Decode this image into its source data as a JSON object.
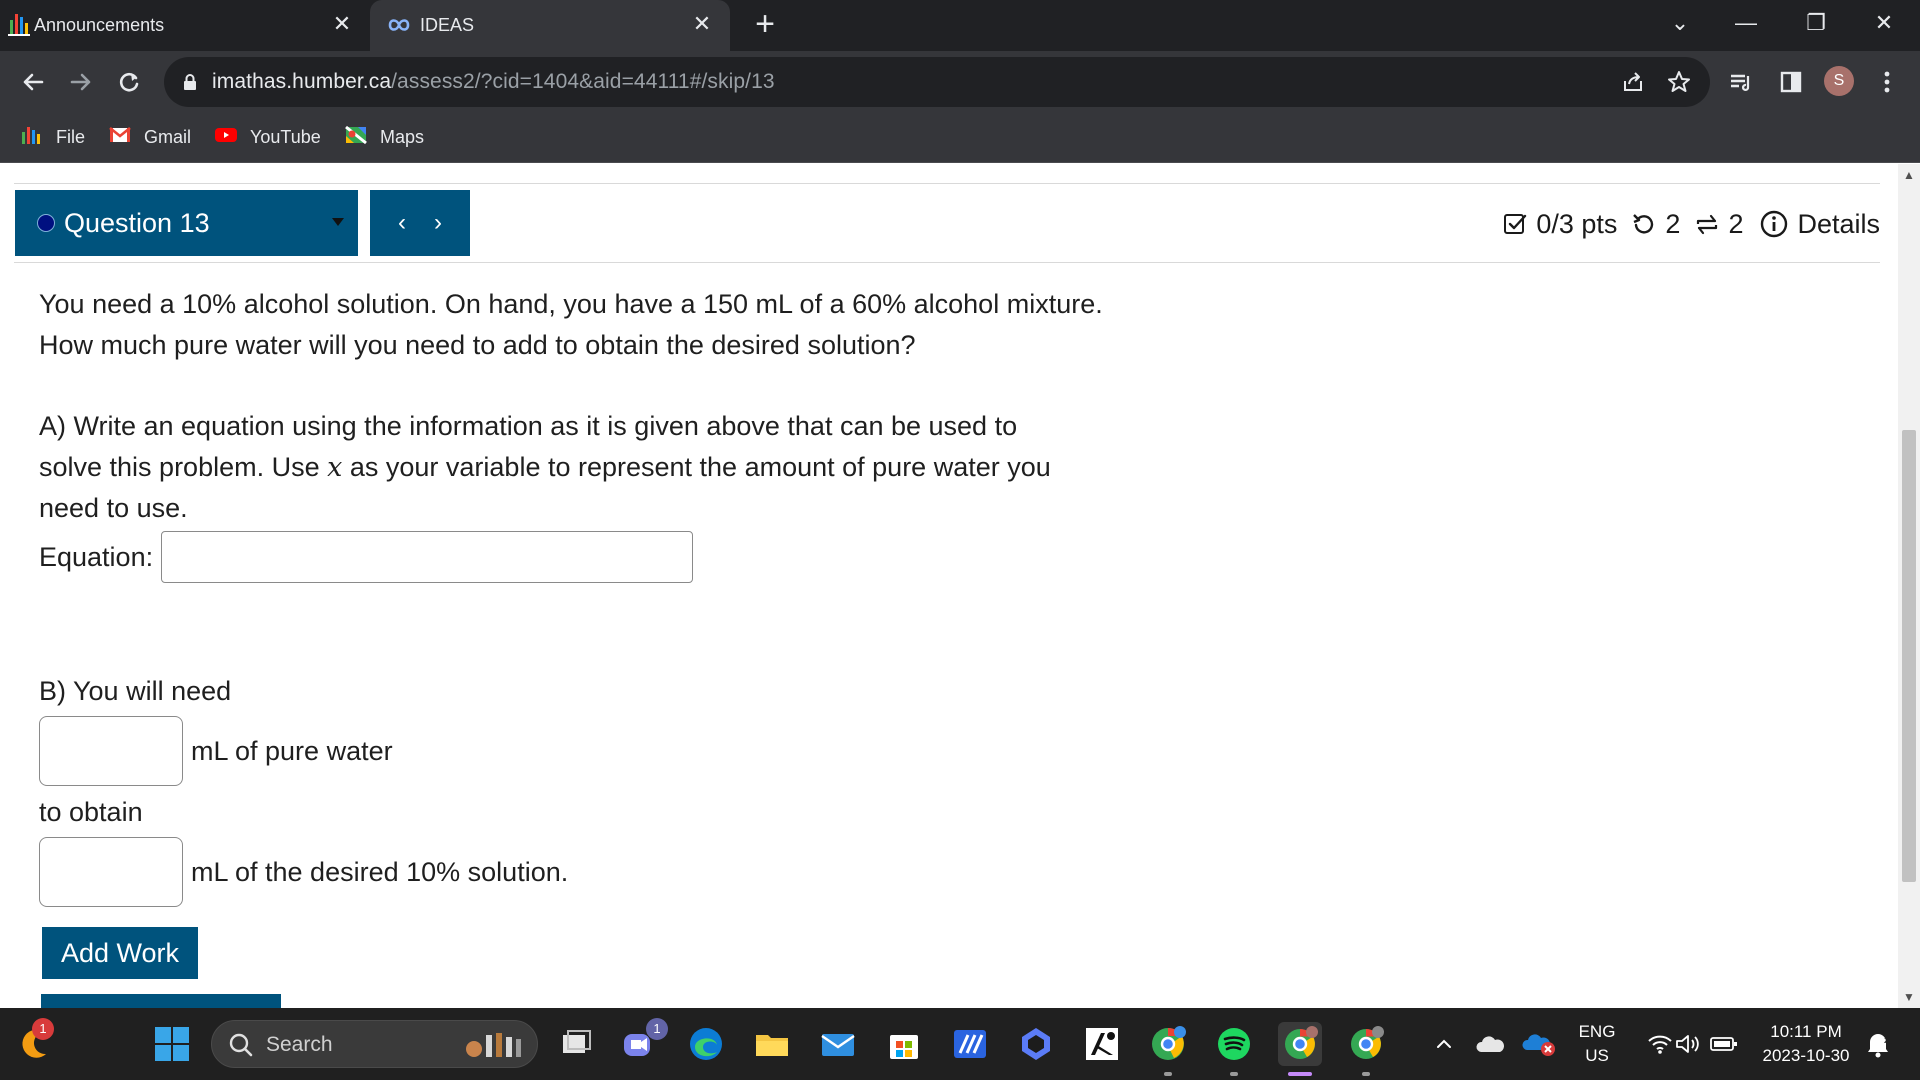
{
  "browser": {
    "tabs": [
      {
        "title": "Announcements",
        "active": false
      },
      {
        "title": "IDEAS",
        "active": true
      }
    ],
    "close_glyph": "✕",
    "new_tab_glyph": "+",
    "window_controls": {
      "tablist": "⌄",
      "minimize": "—",
      "restore": "❐",
      "close": "✕"
    },
    "url_host": "imathas.humber.ca",
    "url_path": "/assess2/?cid=1404&aid=44111#/skip/13",
    "profile_initial": "S",
    "bookmarks": [
      {
        "label": "File",
        "icon": "bar-chart-icon"
      },
      {
        "label": "Gmail",
        "icon": "gmail-icon"
      },
      {
        "label": "YouTube",
        "icon": "youtube-icon"
      },
      {
        "label": "Maps",
        "icon": "maps-icon"
      }
    ]
  },
  "question": {
    "selector_label": "Question 13",
    "prev_glyph": "‹",
    "next_glyph": "›",
    "points": "0/3 pts",
    "retries": "2",
    "attempts": "2",
    "details_label": "Details",
    "line1": "You need a 10% alcohol solution. On hand, you have a 150 mL of a 60% alcohol mixture.",
    "line2": "How much pure water will you need to add to obtain the desired solution?",
    "partA_line1": "A) Write an equation using the information as it is given above that can be used to",
    "partA_line2_pre": "solve this problem. Use ",
    "partA_var": "x",
    "partA_line2_post": " as your variable to represent the amount of pure water you",
    "partA_line3": "need to use.",
    "equation_label": "Equation:",
    "equation_value": "",
    "partB_intro": "B) You will need",
    "water_value": "",
    "water_suffix": "mL of pure water",
    "to_obtain": "to obtain",
    "solution_value": "",
    "solution_suffix": "mL of the desired 10% solution.",
    "add_work_label": "Add Work"
  },
  "taskbar": {
    "search_label": "Search",
    "weather_badge": "1",
    "teams_badge": "1",
    "language_top": "ENG",
    "language_bottom": "US",
    "time": "10:11 PM",
    "date": "2023-10-30"
  },
  "colors": {
    "accent": "#00537d",
    "chrome_dark": "#202124",
    "chrome_mid": "#35363a",
    "taskbar": "#202020"
  }
}
